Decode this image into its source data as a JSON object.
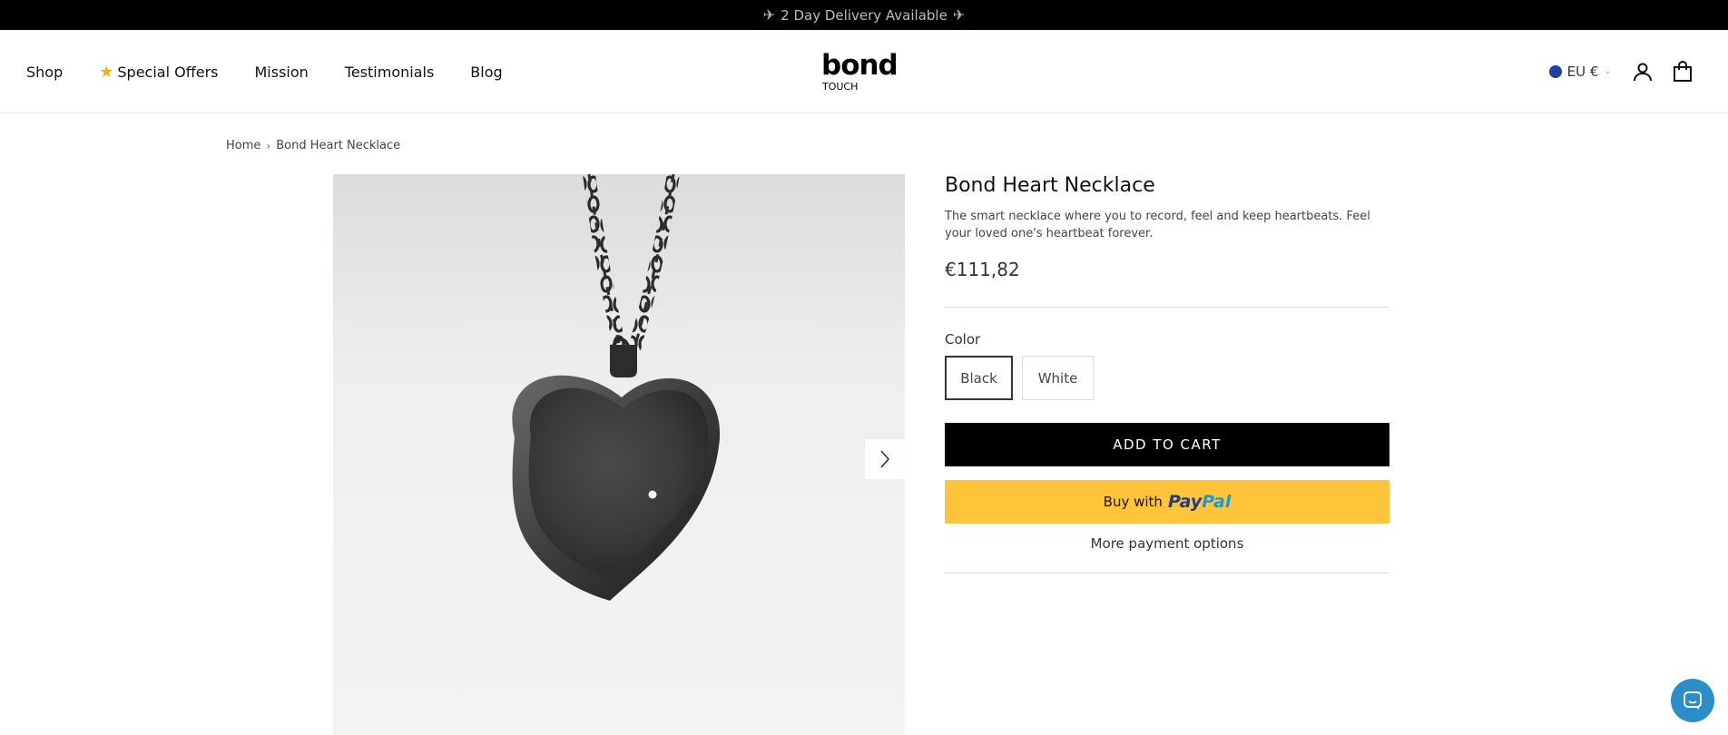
{
  "announcement": {
    "text": "2 Day Delivery Available"
  },
  "nav": {
    "items": [
      {
        "label": "Shop"
      },
      {
        "label": "Special Offers"
      },
      {
        "label": "Mission"
      },
      {
        "label": "Testimonials"
      },
      {
        "label": "Blog"
      }
    ]
  },
  "logo": {
    "word": "bond",
    "sub": "TOUCH"
  },
  "header_tools": {
    "currency": "EU €"
  },
  "breadcrumb": {
    "home": "Home",
    "current": "Bond Heart Necklace"
  },
  "product": {
    "title": "Bond Heart Necklace",
    "description": "The smart necklace where you to record, feel and keep heartbeats. Feel your loved one's heartbeat forever.",
    "price": "€111,82",
    "color_label": "Color",
    "colors": [
      {
        "label": "Black",
        "selected": true
      },
      {
        "label": "White",
        "selected": false
      }
    ],
    "add_to_cart": "ADD TO CART",
    "paypal_prefix": "Buy with",
    "paypal_brand_1": "Pay",
    "paypal_brand_2": "Pal",
    "more_payment": "More payment options"
  },
  "colors": {
    "accent_black": "#000000",
    "paypal_yellow": "#ffc439",
    "chat_blue": "#2b8ec9"
  },
  "icons": [
    "plane-icon",
    "star-icon",
    "globe-flag-icon",
    "account-icon",
    "bag-icon",
    "chevron-right-icon",
    "chat-icon"
  ]
}
